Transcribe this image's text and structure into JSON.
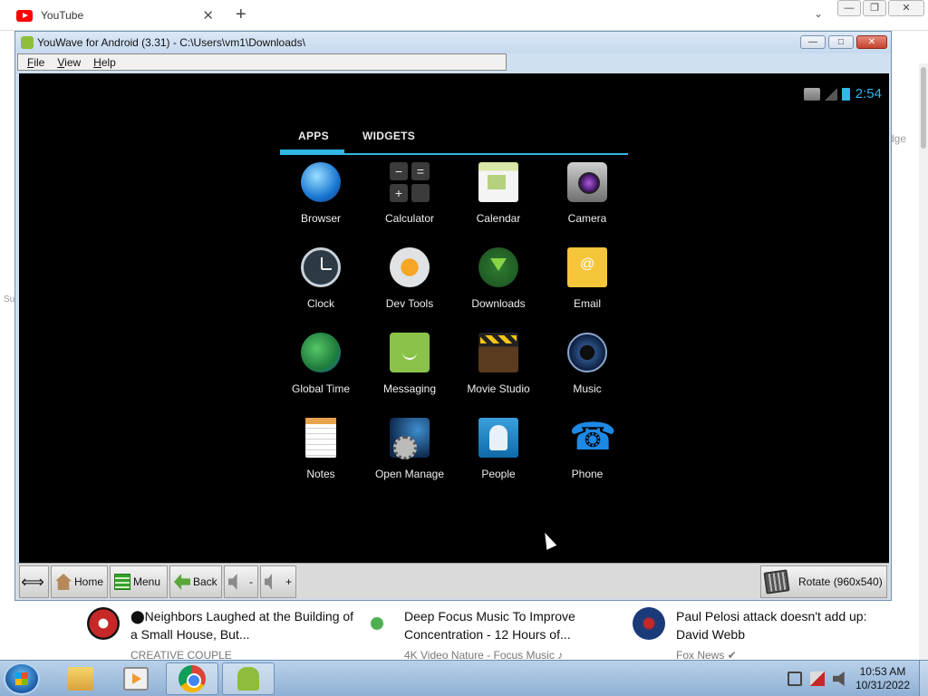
{
  "browser": {
    "tab_title": "YouTube",
    "tab_close": "✕",
    "new_tab": "+",
    "tab_search": "⌄",
    "partial_right_text": "dge",
    "partial_left_text": "Su"
  },
  "emulator": {
    "title": "YouWave for Android (3.31) - C:\\Users\\vm1\\Downloads\\",
    "menu": [
      "File",
      "View",
      "Help"
    ],
    "window_buttons": {
      "minimize": "—",
      "maximize": "□",
      "close": "✕"
    }
  },
  "android": {
    "status": {
      "time": "2:54"
    },
    "tabs": [
      {
        "label": "APPS",
        "active": true
      },
      {
        "label": "WIDGETS",
        "active": false
      }
    ],
    "apps": [
      {
        "label": "Browser",
        "icon": "browser-icon"
      },
      {
        "label": "Calculator",
        "icon": "calculator-icon"
      },
      {
        "label": "Calendar",
        "icon": "calendar-icon"
      },
      {
        "label": "Camera",
        "icon": "camera-icon"
      },
      {
        "label": "Clock",
        "icon": "clock-icon"
      },
      {
        "label": "Dev Tools",
        "icon": "dev-tools-icon"
      },
      {
        "label": "Downloads",
        "icon": "downloads-icon"
      },
      {
        "label": "Email",
        "icon": "email-icon"
      },
      {
        "label": "Global Time",
        "icon": "global-time-icon"
      },
      {
        "label": "Messaging",
        "icon": "messaging-icon"
      },
      {
        "label": "Movie Studio",
        "icon": "movie-studio-icon"
      },
      {
        "label": "Music",
        "icon": "music-icon"
      },
      {
        "label": "Notes",
        "icon": "notes-icon"
      },
      {
        "label": "Open Manage",
        "icon": "open-manager-icon"
      },
      {
        "label": "People",
        "icon": "people-icon"
      },
      {
        "label": "Phone",
        "icon": "phone-icon"
      }
    ],
    "calc_keys": [
      "−",
      "=",
      "+",
      ""
    ]
  },
  "toolbar": {
    "resize": "⟺",
    "home": "Home",
    "menu": "Menu",
    "back": "Back",
    "vol_down": "-",
    "vol_up": "+",
    "rotate": "Rotate (960x540)"
  },
  "recommendations": [
    {
      "title": "⬤Neighbors Laughed at the Building of a Small House, But...",
      "channel": "CREATIVE COUPLE",
      "avatar_color": "#c62828"
    },
    {
      "title": "Deep Focus Music To Improve Concentration - 12 Hours of...",
      "channel": "4K Video Nature - Focus Music ♪",
      "avatar_color": "#4caf50"
    },
    {
      "title": "Paul Pelosi attack doesn't add up: David Webb",
      "channel": "Fox News ✔",
      "avatar_color": "#1a3a7a"
    }
  ],
  "taskbar": {
    "time": "10:53 AM",
    "date": "10/31/2022"
  },
  "colors": {
    "android_accent": "#33b5e5",
    "youtube_red": "#ff0000"
  }
}
